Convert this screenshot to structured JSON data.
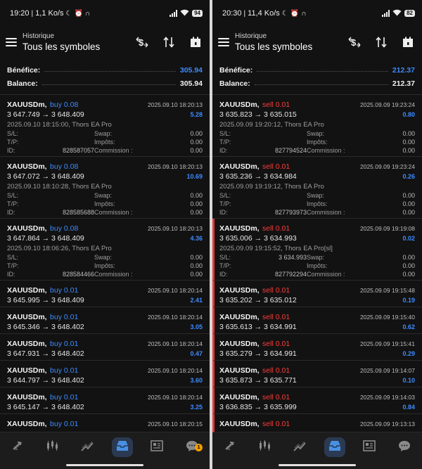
{
  "left": {
    "status": {
      "time": "19:20",
      "speed": "1,1 Ko/s",
      "battery": "94"
    },
    "header": {
      "subtitle": "Historique",
      "title": "Tous les symboles"
    },
    "summary": {
      "profit_label": "Bénéfice:",
      "profit_value": "305.94",
      "balance_label": "Balance:",
      "balance_value": "305.94"
    },
    "deals": [
      {
        "symbol": "XAUUSDm,",
        "type": "buy 0.08",
        "datetime": "2025.09.10 18:20:13",
        "prices": "3 647.749 → 3 648.409",
        "profit": "5.28",
        "detail": "2025.09.10 18:15:00, Thors EA Pro",
        "sl_label": "S/L:",
        "sl_value": "",
        "swap_label": "Swap:",
        "swap_value": "0.00",
        "tp_label": "T/P:",
        "tp_value": "",
        "tax_label": "Impôts:",
        "tax_value": "0.00",
        "id_label": "ID:",
        "id_value": "828587057",
        "comm_label": "Commission :",
        "comm_value": "0.00"
      },
      {
        "symbol": "XAUUSDm,",
        "type": "buy 0.08",
        "datetime": "2025.09.10 18:20:13",
        "prices": "3 647.072 → 3 648.409",
        "profit": "10.69",
        "detail": "2025.09.10 18:10:28, Thors EA Pro",
        "sl_label": "S/L:",
        "sl_value": "",
        "swap_label": "Swap:",
        "swap_value": "0.00",
        "tp_label": "T/P:",
        "tp_value": "",
        "tax_label": "Impôts:",
        "tax_value": "0.00",
        "id_label": "ID:",
        "id_value": "828585688",
        "comm_label": "Commission :",
        "comm_value": "0.00"
      },
      {
        "symbol": "XAUUSDm,",
        "type": "buy 0.08",
        "datetime": "2025.09.10 18:20:13",
        "prices": "3 647.864 → 3 648.409",
        "profit": "4.36",
        "detail": "2025.09.10 18:06:26, Thors EA Pro",
        "sl_label": "S/L:",
        "sl_value": "",
        "swap_label": "Swap:",
        "swap_value": "0.00",
        "tp_label": "T/P:",
        "tp_value": "",
        "tax_label": "Impôts:",
        "tax_value": "0.00",
        "id_label": "ID:",
        "id_value": "828584466",
        "comm_label": "Commission :",
        "comm_value": "0.00"
      },
      {
        "symbol": "XAUUSDm,",
        "type": "buy 0.01",
        "datetime": "2025.09.10 18:20:14",
        "prices": "3 645.995 → 3 648.409",
        "profit": "2.41"
      },
      {
        "symbol": "XAUUSDm,",
        "type": "buy 0.01",
        "datetime": "2025.09.10 18:20:14",
        "prices": "3 645.346 → 3 648.402",
        "profit": "3.05"
      },
      {
        "symbol": "XAUUSDm,",
        "type": "buy 0.01",
        "datetime": "2025.09.10 18:20:14",
        "prices": "3 647.931 → 3 648.402",
        "profit": "0.47"
      },
      {
        "symbol": "XAUUSDm,",
        "type": "buy 0.01",
        "datetime": "2025.09.10 18:20:14",
        "prices": "3 644.797 → 3 648.402",
        "profit": "3.60"
      },
      {
        "symbol": "XAUUSDm,",
        "type": "buy 0.01",
        "datetime": "2025.09.10 18:20:14",
        "prices": "3 645.147 → 3 648.402",
        "profit": "3.25"
      },
      {
        "symbol": "XAUUSDm,",
        "type": "buy 0.01",
        "datetime": "2025.09.10 18:20:15",
        "prices": "",
        "profit": ""
      }
    ],
    "nav_badge": "1"
  },
  "right": {
    "status": {
      "time": "20:30",
      "speed": "11,4 Ko/s",
      "battery": "82"
    },
    "header": {
      "subtitle": "Historique",
      "title": "Tous les symboles"
    },
    "summary": {
      "profit_label": "Bénéfice:",
      "profit_value": "212.37",
      "balance_label": "Balance:",
      "balance_value": "212.37"
    },
    "deals": [
      {
        "symbol": "XAUUSDm,",
        "type": "sell 0.01",
        "datetime": "2025.09.09 19:23:24",
        "prices": "3 635.823 → 3 635.015",
        "profit": "0.80",
        "detail": "2025.09.09 19:20:12, Thors EA Pro",
        "sl_label": "S/L:",
        "sl_value": "",
        "swap_label": "Swap:",
        "swap_value": "0.00",
        "tp_label": "T/P:",
        "tp_value": "",
        "tax_label": "Impôts:",
        "tax_value": "0.00",
        "id_label": "ID:",
        "id_value": "827794524",
        "comm_label": "Commission :",
        "comm_value": "0.00"
      },
      {
        "symbol": "XAUUSDm,",
        "type": "sell 0.01",
        "datetime": "2025.09.09 19:23:24",
        "prices": "3 635.236 → 3 634.984",
        "profit": "0.26",
        "detail": "2025.09.09 19:19:12, Thors EA Pro",
        "sl_label": "S/L:",
        "sl_value": "",
        "swap_label": "Swap:",
        "swap_value": "0.00",
        "tp_label": "T/P:",
        "tp_value": "",
        "tax_label": "Impôts:",
        "tax_value": "0.00",
        "id_label": "ID:",
        "id_value": "827793973",
        "comm_label": "Commission :",
        "comm_value": "0.00"
      },
      {
        "symbol": "XAUUSDm,",
        "type": "sell 0.01",
        "datetime": "2025.09.09 19:19:08",
        "prices": "3 635.006 → 3 634.993",
        "profit": "0.02",
        "flag": true,
        "detail": "2025.09.09 19:15:52, Thors EA Pro[sl]",
        "sl_label": "S/L:",
        "sl_value": "3 634.993",
        "swap_label": "Swap:",
        "swap_value": "0.00",
        "tp_label": "T/P:",
        "tp_value": "",
        "tax_label": "Impôts:",
        "tax_value": "0.00",
        "id_label": "ID:",
        "id_value": "827792294",
        "comm_label": "Commission :",
        "comm_value": "0.00"
      },
      {
        "symbol": "XAUUSDm,",
        "type": "sell 0.01",
        "datetime": "2025.09.09 19:15:48",
        "prices": "3 635.202 → 3 635.012",
        "profit": "0.19",
        "flag": true
      },
      {
        "symbol": "XAUUSDm,",
        "type": "sell 0.01",
        "datetime": "2025.09.09 19:15:40",
        "prices": "3 635.613 → 3 634.991",
        "profit": "0.62",
        "flag": true
      },
      {
        "symbol": "XAUUSDm,",
        "type": "sell 0.01",
        "datetime": "2025.09.09 19:15:41",
        "prices": "3 635.279 → 3 634.991",
        "profit": "0.29",
        "flag": true
      },
      {
        "symbol": "XAUUSDm,",
        "type": "sell 0.01",
        "datetime": "2025.09.09 19:14:07",
        "prices": "3 635.873 → 3 635.771",
        "profit": "0.10",
        "flag": true
      },
      {
        "symbol": "XAUUSDm,",
        "type": "sell 0.01",
        "datetime": "2025.09.09 19:14:03",
        "prices": "3 636.835 → 3 635.999",
        "profit": "0.84",
        "flag": true
      },
      {
        "symbol": "XAUUSDm,",
        "type": "sell 0.01",
        "datetime": "2025.09.09 19:13:13",
        "prices": "",
        "profit": "",
        "flag": true
      }
    ],
    "nav_badge": ""
  },
  "colors": {
    "buy": "#3d8bff",
    "sell": "#ff3b3b",
    "profit": "#3d8bff",
    "flag": "#e53935"
  },
  "nav_icons": [
    "quotes-icon",
    "chart-candles-icon",
    "trade-icon",
    "history-icon",
    "news-icon",
    "chat-icon"
  ]
}
